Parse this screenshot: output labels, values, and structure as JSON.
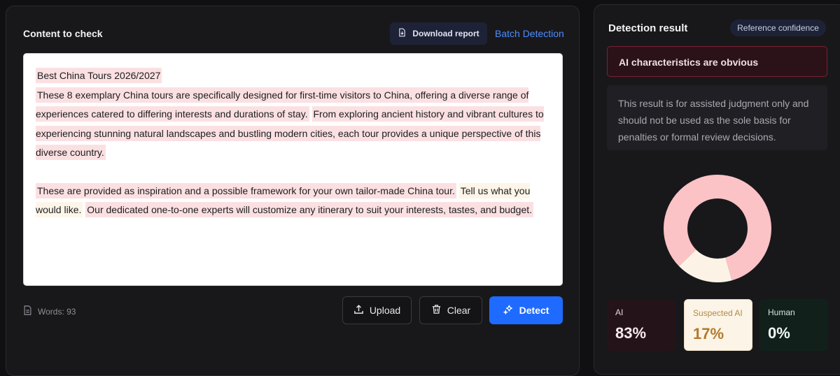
{
  "check_panel": {
    "title": "Content to check",
    "download_label": "Download report",
    "batch_label": "Batch Detection",
    "paragraphs": [
      [
        {
          "text": "Best China Tours 2026/2027",
          "type": "ai"
        },
        {
          "text": " "
        },
        {
          "text": "These 8 exemplary China tours are specifically designed for first-time visitors to China, offering a diverse range of experiences catered to differing interests and durations of stay.",
          "type": "ai"
        },
        {
          "text": " "
        },
        {
          "text": "From exploring ancient history and vibrant cultures to experiencing stunning natural landscapes and bustling modern cities, each tour provides a unique perspective of this diverse country.",
          "type": "ai"
        }
      ],
      [
        {
          "text": "These are provided as inspiration and a possible framework for your own tailor-made China tour.",
          "type": "ai"
        },
        {
          "text": " "
        },
        {
          "text": "Tell us what you would like.",
          "type": "sus"
        },
        {
          "text": " "
        },
        {
          "text": "Our dedicated one-to-one experts will customize any itinerary to suit your interests, tastes, and budget.",
          "type": "ai"
        }
      ]
    ],
    "word_count": "Words: 93",
    "upload_label": "Upload",
    "clear_label": "Clear",
    "detect_label": "Detect"
  },
  "result_panel": {
    "title": "Detection result",
    "confidence_badge": "Reference confidence",
    "verdict": "AI characteristics are obvious",
    "disclaimer": "This result is for assisted judgment only and should not be used as the sole basis for penalties or formal review decisions.",
    "breakdown": [
      {
        "label": "AI",
        "value": "83%",
        "fraction": 0.83,
        "color": "#fcc3c6"
      },
      {
        "label": "Suspected AI",
        "value": "17%",
        "fraction": 0.17,
        "color": "#fcf3e6"
      },
      {
        "label": "Human",
        "value": "0%",
        "fraction": 0.0,
        "color": "#1f5a45"
      }
    ]
  },
  "icons": {
    "download": "file-download-icon",
    "words": "document-icon",
    "upload": "upload-icon",
    "clear": "trash-icon",
    "detect": "sparkle-icon"
  }
}
